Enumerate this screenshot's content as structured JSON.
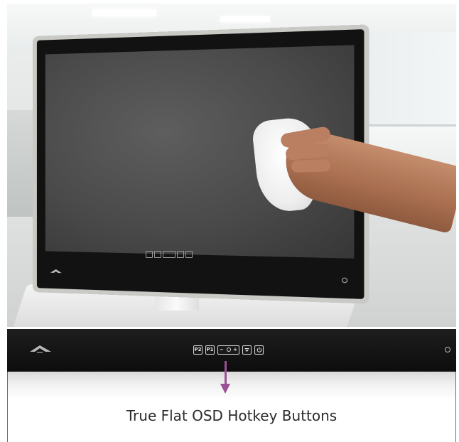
{
  "photo": {
    "description_icon": "monitor-photo"
  },
  "osd_strip": {
    "buttons": [
      "P2",
      "P1",
      "",
      "",
      ""
    ],
    "brightness_minus": "−",
    "brightness_plus": "+",
    "power_icon": "power-icon"
  },
  "caption": {
    "text": "True Flat OSD Hotkey Buttons"
  },
  "colors": {
    "arrow": "#9b4f96",
    "strip": "#141414"
  }
}
